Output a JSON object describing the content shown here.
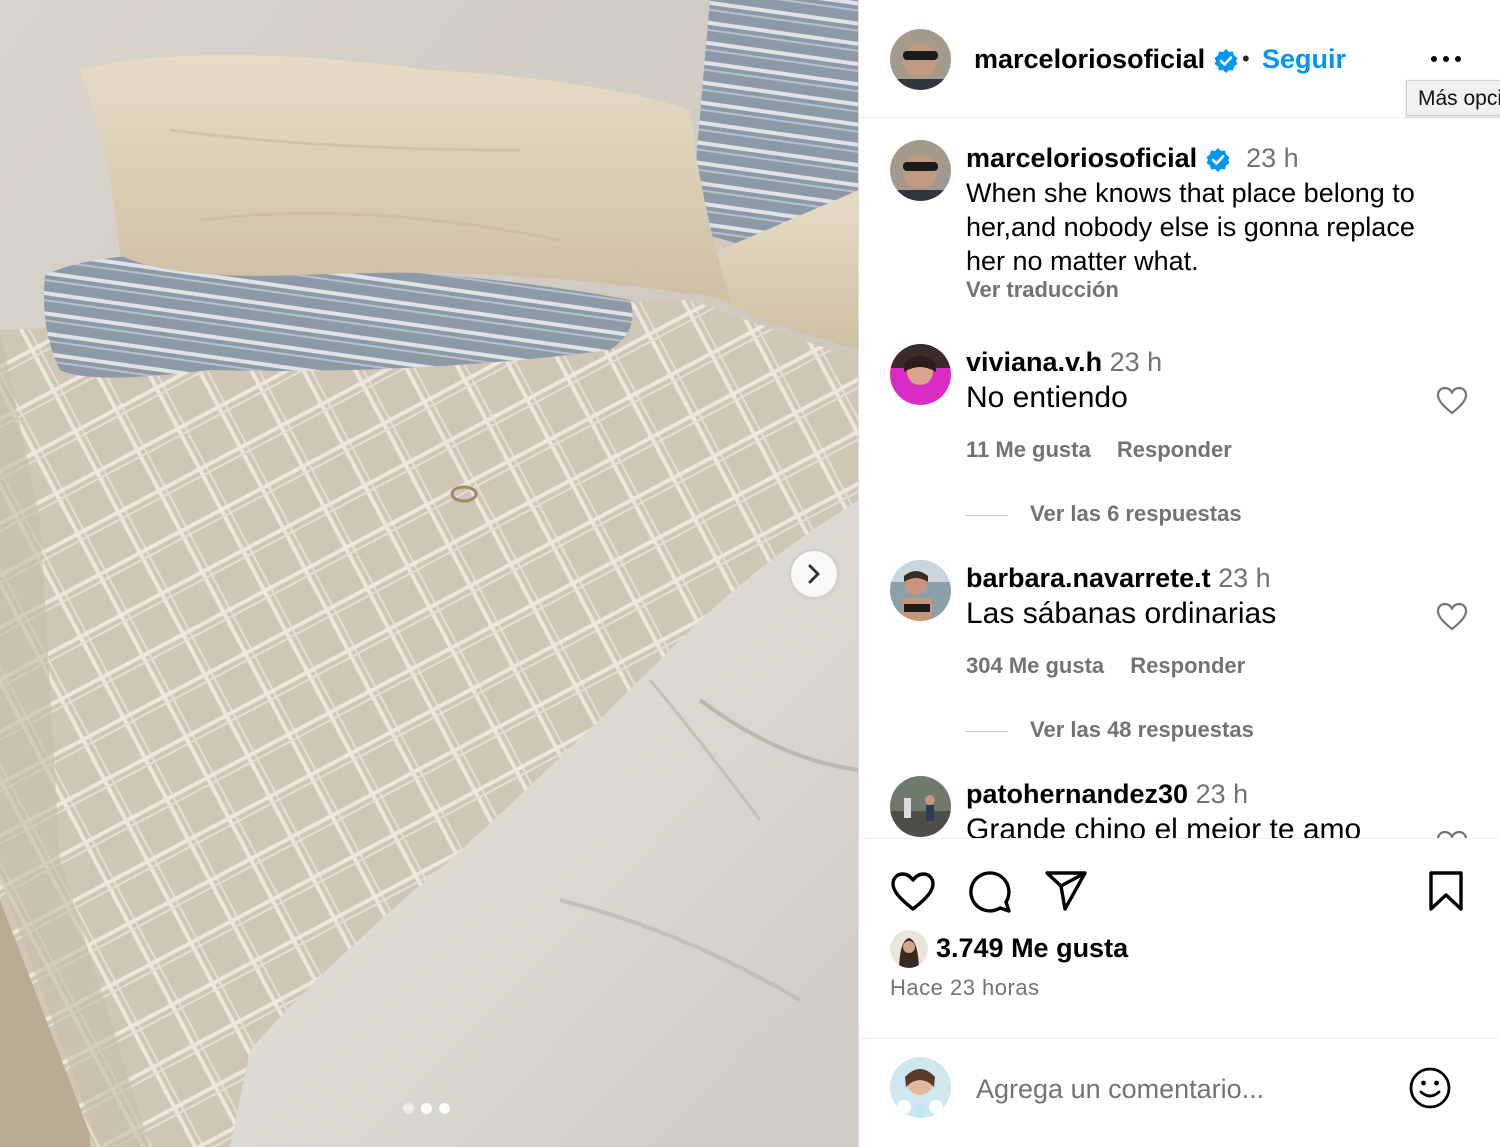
{
  "post": {
    "author": "marceloriosoficial",
    "follow_label": "Seguir",
    "separator": "•",
    "more_icon": "more-horizontal-icon",
    "tooltip": "Más opciones",
    "photo_dots": {
      "count": 3,
      "active": 1
    }
  },
  "caption": {
    "user": "marceloriosoficial",
    "time": "23 h",
    "text": "When she knows that place belong to her,and nobody else is gonna replace her no matter what.",
    "translate": "Ver traducción"
  },
  "comments": [
    {
      "user": "viviana.v.h",
      "time": "23 h",
      "text": "No entiendo",
      "likes": "11 Me gusta",
      "reply": "Responder",
      "replies": "Ver las 6 respuestas"
    },
    {
      "user": "barbara.navarrete.t",
      "time": "23 h",
      "text": "Las sábanas ordinarias",
      "likes": "304 Me gusta",
      "reply": "Responder",
      "replies": "Ver las 48 respuestas"
    },
    {
      "user": "patohernandez30",
      "time": "23 h",
      "text": "Grande chino el mejor te amo"
    }
  ],
  "summary": {
    "likes": "3.749 Me gusta",
    "posted": "Hace 23 horas"
  },
  "composer": {
    "placeholder": "Agrega un comentario..."
  },
  "colors": {
    "link": "#0095f6",
    "muted": "#737373",
    "verified": "#0095f6"
  }
}
